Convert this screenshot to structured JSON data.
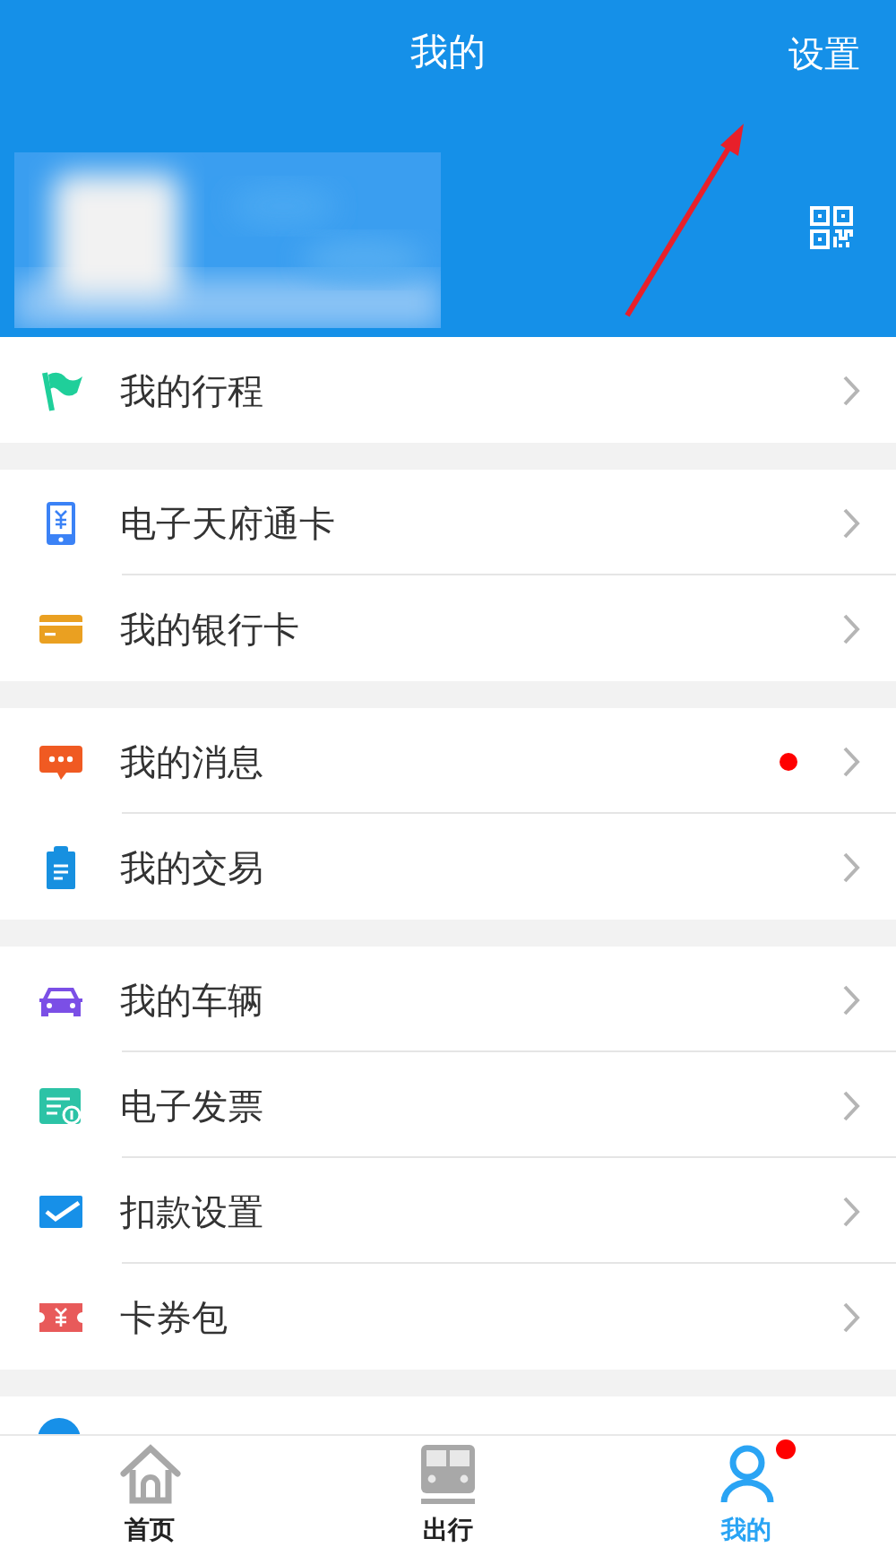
{
  "header": {
    "title": "我的",
    "action": "设置"
  },
  "groups": [
    {
      "items": [
        {
          "label": "我的行程",
          "badge": false
        }
      ]
    },
    {
      "items": [
        {
          "label": "电子天府通卡",
          "badge": false
        },
        {
          "label": "我的银行卡",
          "badge": false
        }
      ]
    },
    {
      "items": [
        {
          "label": "我的消息",
          "badge": true
        },
        {
          "label": "我的交易",
          "badge": false
        }
      ]
    },
    {
      "items": [
        {
          "label": "我的车辆",
          "badge": false
        },
        {
          "label": "电子发票",
          "badge": false
        },
        {
          "label": "扣款设置",
          "badge": false
        },
        {
          "label": "卡券包",
          "badge": false
        }
      ]
    }
  ],
  "tabs": [
    {
      "label": "首页",
      "selected": false,
      "badge": false
    },
    {
      "label": "出行",
      "selected": false,
      "badge": false
    },
    {
      "label": "我的",
      "selected": true,
      "badge": true
    }
  ]
}
